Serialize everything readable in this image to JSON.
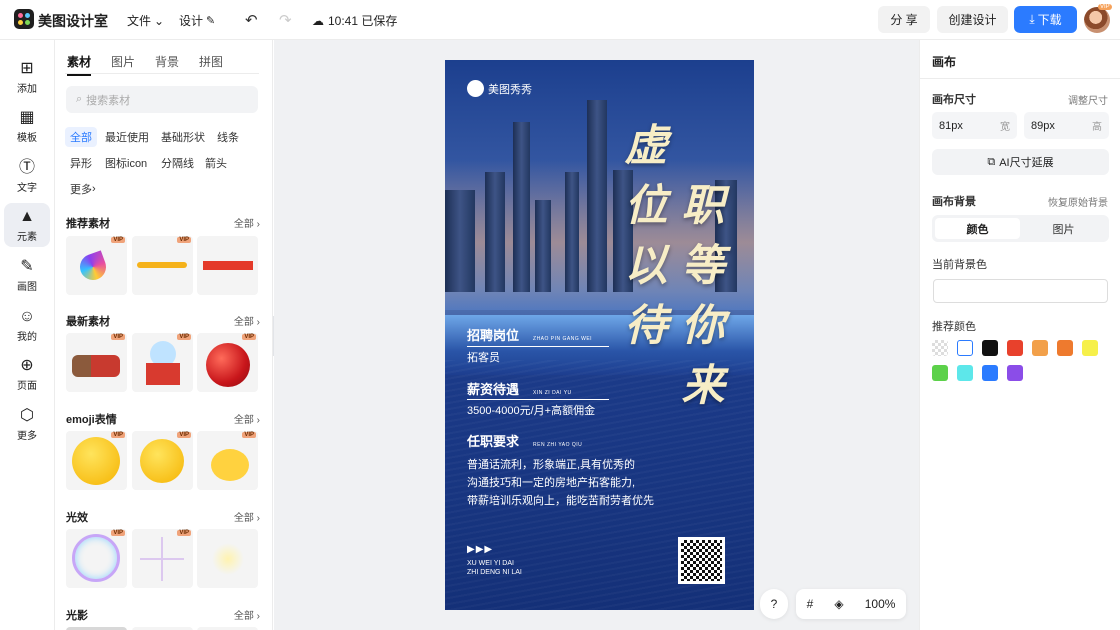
{
  "app": {
    "name": "美图设计室"
  },
  "topbar": {
    "file_label": "文件",
    "design_label": "设计",
    "saved_status": "10:41 已保存",
    "share_label": "分 享",
    "create_label": "创建设计",
    "download_label": "下载",
    "avatar_badge": "VIP"
  },
  "rail": {
    "items": [
      {
        "label": "添加",
        "icon": "plus-icon"
      },
      {
        "label": "模板",
        "icon": "template-icon"
      },
      {
        "label": "文字",
        "icon": "text-icon"
      },
      {
        "label": "元素",
        "icon": "element-icon"
      },
      {
        "label": "画图",
        "icon": "draw-icon"
      },
      {
        "label": "我的",
        "icon": "user-icon"
      },
      {
        "label": "页面",
        "icon": "page-icon"
      },
      {
        "label": "更多",
        "icon": "cube-icon"
      }
    ]
  },
  "panel": {
    "tabs": [
      "素材",
      "图片",
      "背景",
      "拼图"
    ],
    "search_placeholder": "搜索素材",
    "chips": [
      "全部",
      "最近使用",
      "基础形状",
      "线条",
      "异形",
      "图标icon",
      "分隔线",
      "箭头",
      "更多"
    ],
    "sections": [
      {
        "title": "推荐素材",
        "more": "全部"
      },
      {
        "title": "最新素材",
        "more": "全部"
      },
      {
        "title": "emoji表情",
        "more": "全部"
      },
      {
        "title": "光效",
        "more": "全部"
      },
      {
        "title": "光影",
        "more": "全部"
      }
    ],
    "vip_badge": "VIP"
  },
  "poster": {
    "brand": "美图秀秀",
    "headline_col1": [
      "虚",
      "位",
      "以",
      "待"
    ],
    "headline_col2": [
      "职",
      "等",
      "你",
      "来"
    ],
    "job_title": "招聘岗位",
    "job_pinyin": "ZHAO PIN GANG WEI",
    "job_value": "拓客员",
    "salary_title": "薪资待遇",
    "salary_pinyin": "XIN ZI DAI YU",
    "salary_value": "3500-4000元/月+高额佣金",
    "req_title": "任职要求",
    "req_pinyin": "REN ZHI YAO QIU",
    "req_lines": [
      "普通话流利，形象端正,具有优秀的",
      "沟通技巧和一定的房地产拓客能力,",
      "带薪培训乐观向上，能吃苦耐劳者优先"
    ],
    "footer_line1": "XU WEI YI DAI",
    "footer_line2": "ZHI DENG NI LAI"
  },
  "canvas_controls": {
    "help": "?",
    "zoom": "100%"
  },
  "right": {
    "title": "画布",
    "size_label": "画布尺寸",
    "size_link": "调整尺寸",
    "width_value": "81px",
    "width_unit": "宽",
    "height_value": "89px",
    "height_unit": "高",
    "ai_button": "AI尺寸延展",
    "bg_label": "画布背景",
    "bg_link": "恢复原始背景",
    "seg_color": "颜色",
    "seg_image": "图片",
    "current_bg_label": "当前背景色",
    "recommend_label": "推荐颜色",
    "swatches": [
      "transparent",
      "#ffffff",
      "#111111",
      "#e8412c",
      "#f2a04a",
      "#ee7a2e",
      "#f6f04a",
      "#5cd14a",
      "#5de7ea",
      "#2b7bff",
      "#8b4de8"
    ]
  }
}
